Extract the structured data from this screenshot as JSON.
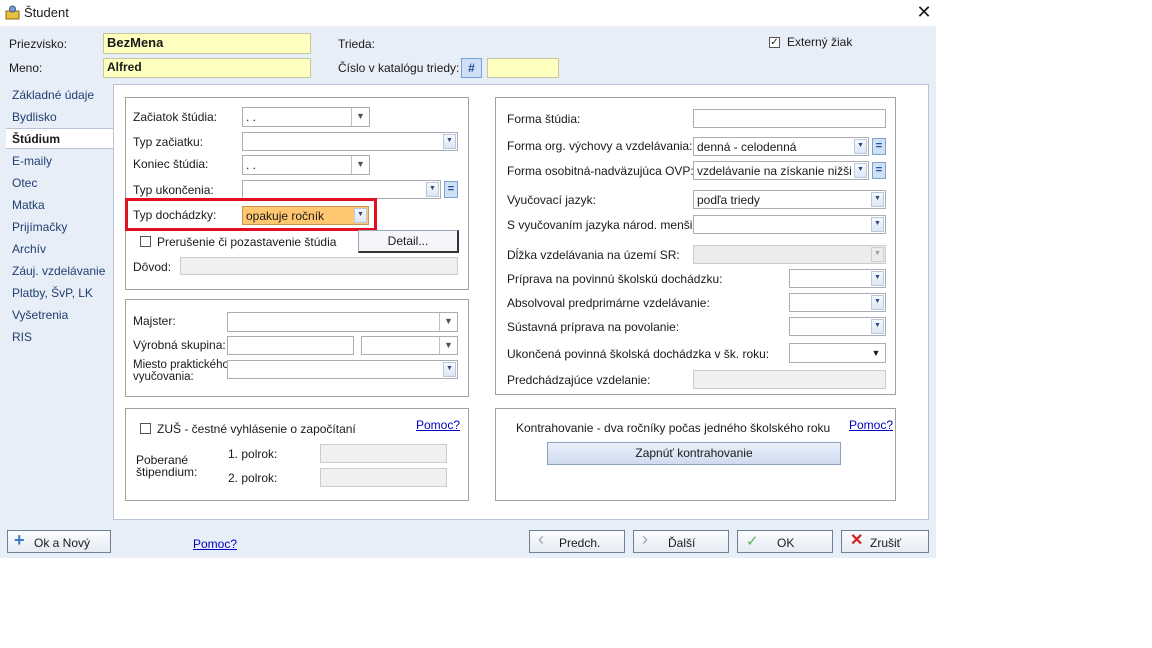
{
  "window": {
    "title": "Študent"
  },
  "header": {
    "surname_label": "Priezvisko:",
    "surname_value": "BezMena",
    "name_label": "Meno:",
    "name_value": "Alfred",
    "class_label": "Trieda:",
    "catalog_label": "Číslo v katalógu triedy:",
    "catalog_button": "#",
    "external_label": "Externý žiak",
    "external_checked": "✓"
  },
  "sidebar": {
    "items": [
      "Základné údaje",
      "Bydlisko",
      "Štúdium",
      "E-maily",
      "Otec",
      "Matka",
      "Prijímačky",
      "Archív",
      "Záuj. vzdelávanie",
      "Platby, ŠvP, LK",
      "Vyšetrenia",
      "RIS"
    ],
    "selected": "Štúdium"
  },
  "study": {
    "start_label": "Začiatok štúdia:",
    "start_value": "  .    .",
    "start_type_label": "Typ začiatku:",
    "end_label": "Koniec štúdia:",
    "end_value": "  .    .",
    "end_type_label": "Typ ukončenia:",
    "attendance_label": "Typ dochádzky:",
    "attendance_value": "opakuje ročník",
    "interrupt_label": "Prerušenie či pozastavenie štúdia",
    "detail_button": "Detail...",
    "reason_label": "Dôvod:"
  },
  "practice": {
    "master_label": "Majster:",
    "group_label": "Výrobná skupina:",
    "place_label": "Miesto praktického vyučovania:"
  },
  "zus": {
    "check_label": "ZUŠ - čestné vyhlásenie o započítaní",
    "help_link": "Pomoc?",
    "scholarship_label": "Poberané štipendium:",
    "sem1_label": "1. polrok:",
    "sem2_label": "2. polrok:"
  },
  "right": {
    "form_label": "Forma štúdia:",
    "org_form_label": "Forma org. výchovy a vzdelávania:",
    "org_form_value": "denná - celodenná",
    "special_form_label": "Forma osobitná-nadväzujúca OVP:",
    "special_form_value": "vzdelávanie na získanie nižšieh",
    "language_label": "Vyučovací jazyk:",
    "language_value": "podľa triedy",
    "minority_label": "S vyučovaním jazyka národ. menšiny:",
    "duration_label": "Dĺžka vzdelávania na území SR:",
    "prep_label": "Príprava na povinnú školskú dochádzku:",
    "preprimary_label": "Absolvoval predprimárne vzdelávanie:",
    "system_prep_label": "Sústavná príprava na povolanie:",
    "completed_label": "Ukončená povinná školská dochádzka v šk. roku:",
    "previous_label": "Predchádzajúce vzdelanie:"
  },
  "contract": {
    "label": "Kontrahovanie - dva ročníky počas jedného školského roku",
    "help_link": "Pomoc?",
    "button": "Zapnúť kontrahovanie"
  },
  "footer": {
    "ok_new": "Ok a Nový",
    "help_link": "Pomoc?",
    "prev": "Predch.",
    "next": "Ďalší",
    "ok": "OK",
    "cancel": "Zrušiť"
  },
  "colors": {
    "highlight_box": "#e01020",
    "required_field": "#ffffc0"
  }
}
